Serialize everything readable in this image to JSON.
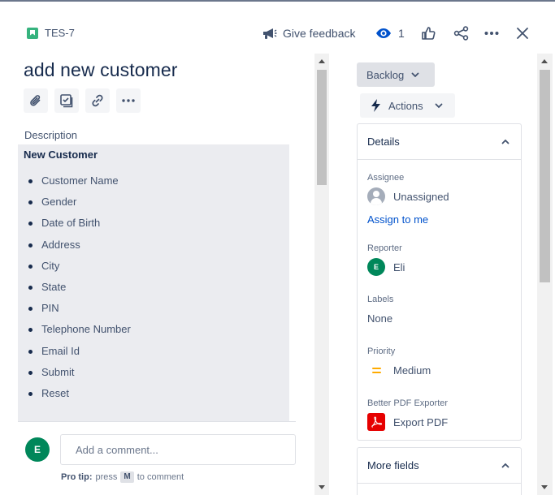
{
  "issue": {
    "key": "TES-7",
    "title": "add new customer"
  },
  "header": {
    "feedback_label": "Give feedback",
    "watch_count": "1"
  },
  "description": {
    "label": "Description",
    "heading": "New Customer",
    "items": [
      "Customer Name",
      "Gender",
      "Date of Birth",
      "Address",
      "City",
      "State",
      "PIN",
      "Telephone Number",
      "Email Id",
      "Submit",
      "Reset"
    ]
  },
  "comment": {
    "avatar_initial": "E",
    "placeholder": "Add a comment...",
    "pro_tip_label": "Pro tip:",
    "pro_tip_press": "press",
    "pro_tip_key": "M",
    "pro_tip_suffix": "to comment"
  },
  "sidebar": {
    "status": "Backlog",
    "actions_label": "Actions",
    "details_title": "Details",
    "more_fields_title": "More fields",
    "fields": {
      "assignee_label": "Assignee",
      "assignee_value": "Unassigned",
      "assign_to_me": "Assign to me",
      "reporter_label": "Reporter",
      "reporter_initial": "E",
      "reporter_value": "Eli",
      "labels_label": "Labels",
      "labels_value": "None",
      "priority_label": "Priority",
      "priority_value": "Medium",
      "pdf_label": "Better PDF Exporter",
      "pdf_value": "Export PDF"
    }
  },
  "colors": {
    "story": "#36b37e",
    "link": "#0052cc",
    "avatar": "#00875a",
    "priority_medium": "#ffab00",
    "pdf_red": "#e60000"
  }
}
